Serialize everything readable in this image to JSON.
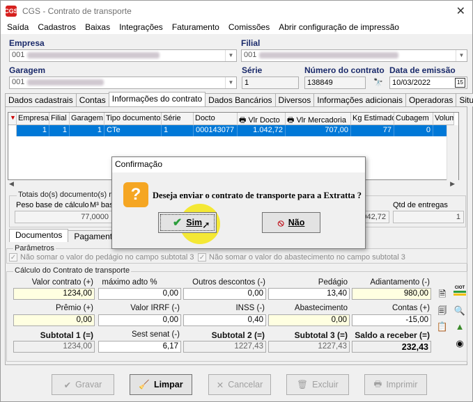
{
  "window": {
    "title": "CGS - Contrato de transporte",
    "logo": "CGS"
  },
  "menu": [
    "Saída",
    "Cadastros",
    "Baixas",
    "Integrações",
    "Faturamento",
    "Comissões",
    "Abrir configuração de impressão"
  ],
  "header": {
    "empresa_label": "Empresa",
    "empresa_code": "001",
    "filial_label": "Filial",
    "filial_code": "001",
    "garagem_label": "Garagem",
    "garagem_code": "001",
    "serie_label": "Série",
    "serie_value": "1",
    "numero_label": "Número do contrato",
    "numero_value": "138849",
    "emissao_label": "Data de emissão",
    "emissao_value": "10/03/2022"
  },
  "tabs": [
    "Dados cadastrais",
    "Contas",
    "Informações do contrato",
    "Dados Bancários",
    "Diversos",
    "Informações adicionais",
    "Operadoras",
    "Situação"
  ],
  "active_tab": "Informações do contrato",
  "grid": {
    "columns": [
      "Empresa",
      "Filial",
      "Garagem",
      "Tipo documento",
      "Série",
      "Docto",
      "Vlr Docto",
      "Vlr Mercadoria",
      "Kg Estimado",
      "Cubagem",
      "Volum"
    ],
    "rows": [
      [
        "1",
        "1",
        "1",
        "CTe",
        "1",
        "000143077",
        "1.042,72",
        "707,00",
        "77",
        "0",
        ""
      ]
    ]
  },
  "totals": {
    "group_title": "Totais do(s) documento(s) re",
    "peso_label": "Peso base de cálculo",
    "peso_value": "77,0000",
    "m3_label": "M³ bas",
    "value_right": "1.042,72",
    "entregas_label": "Qtd de entregas",
    "entregas_value": "1"
  },
  "subtabs": [
    "Documentos",
    "Pagamento"
  ],
  "params": {
    "title": "Parâmetros",
    "opt1": "Não somar o valor do pedágio no campo subtotal 3",
    "opt2": "Não somar o valor do abastecimento no campo subtotal 3"
  },
  "calc": {
    "title": "Cálculo do Contrato de transporte",
    "valor_contrato_label": "Valor contrato (+)",
    "valor_contrato": "1234,00",
    "maximo_label": "máximo adto %",
    "maximo": "0,00",
    "outros_label": "Outros descontos (-)",
    "outros": "0,00",
    "pedagio_label": "Pedágio",
    "pedagio": "13,40",
    "adiantamento_label": "Adiantamento (-)",
    "adiantamento": "980,00",
    "premio_label": "Prêmio (+)",
    "premio": "0,00",
    "irrf_label": "Valor IRRF (-)",
    "irrf": "0,00",
    "inss_label": "INSS (-)",
    "inss": "0,40",
    "abastecimento_label": "Abastecimento",
    "abastecimento": "0,00",
    "contas_label": "Contas (+)",
    "contas": "-15,00",
    "sub1_label": "Subtotal 1 (=)",
    "sub1": "1234,00",
    "sest_label": "Sest senat (-)",
    "sest": "6,17",
    "sub2_label": "Subtotal 2 (=)",
    "sub2": "1227,43",
    "sub3_label": "Subtotal 3 (=)",
    "sub3": "1227,43",
    "saldo_label": "Saldo a receber (=)",
    "saldo": "232,43",
    "ciot": "CIOT"
  },
  "buttons": {
    "gravar": "Gravar",
    "limpar": "Limpar",
    "cancelar": "Cancelar",
    "excluir": "Excluir",
    "imprimir": "Imprimir"
  },
  "dialog": {
    "title": "Confirmação",
    "message": "Deseja enviar o contrato de transporte para a Extratta ?",
    "yes": "Sim",
    "no": "Não"
  }
}
